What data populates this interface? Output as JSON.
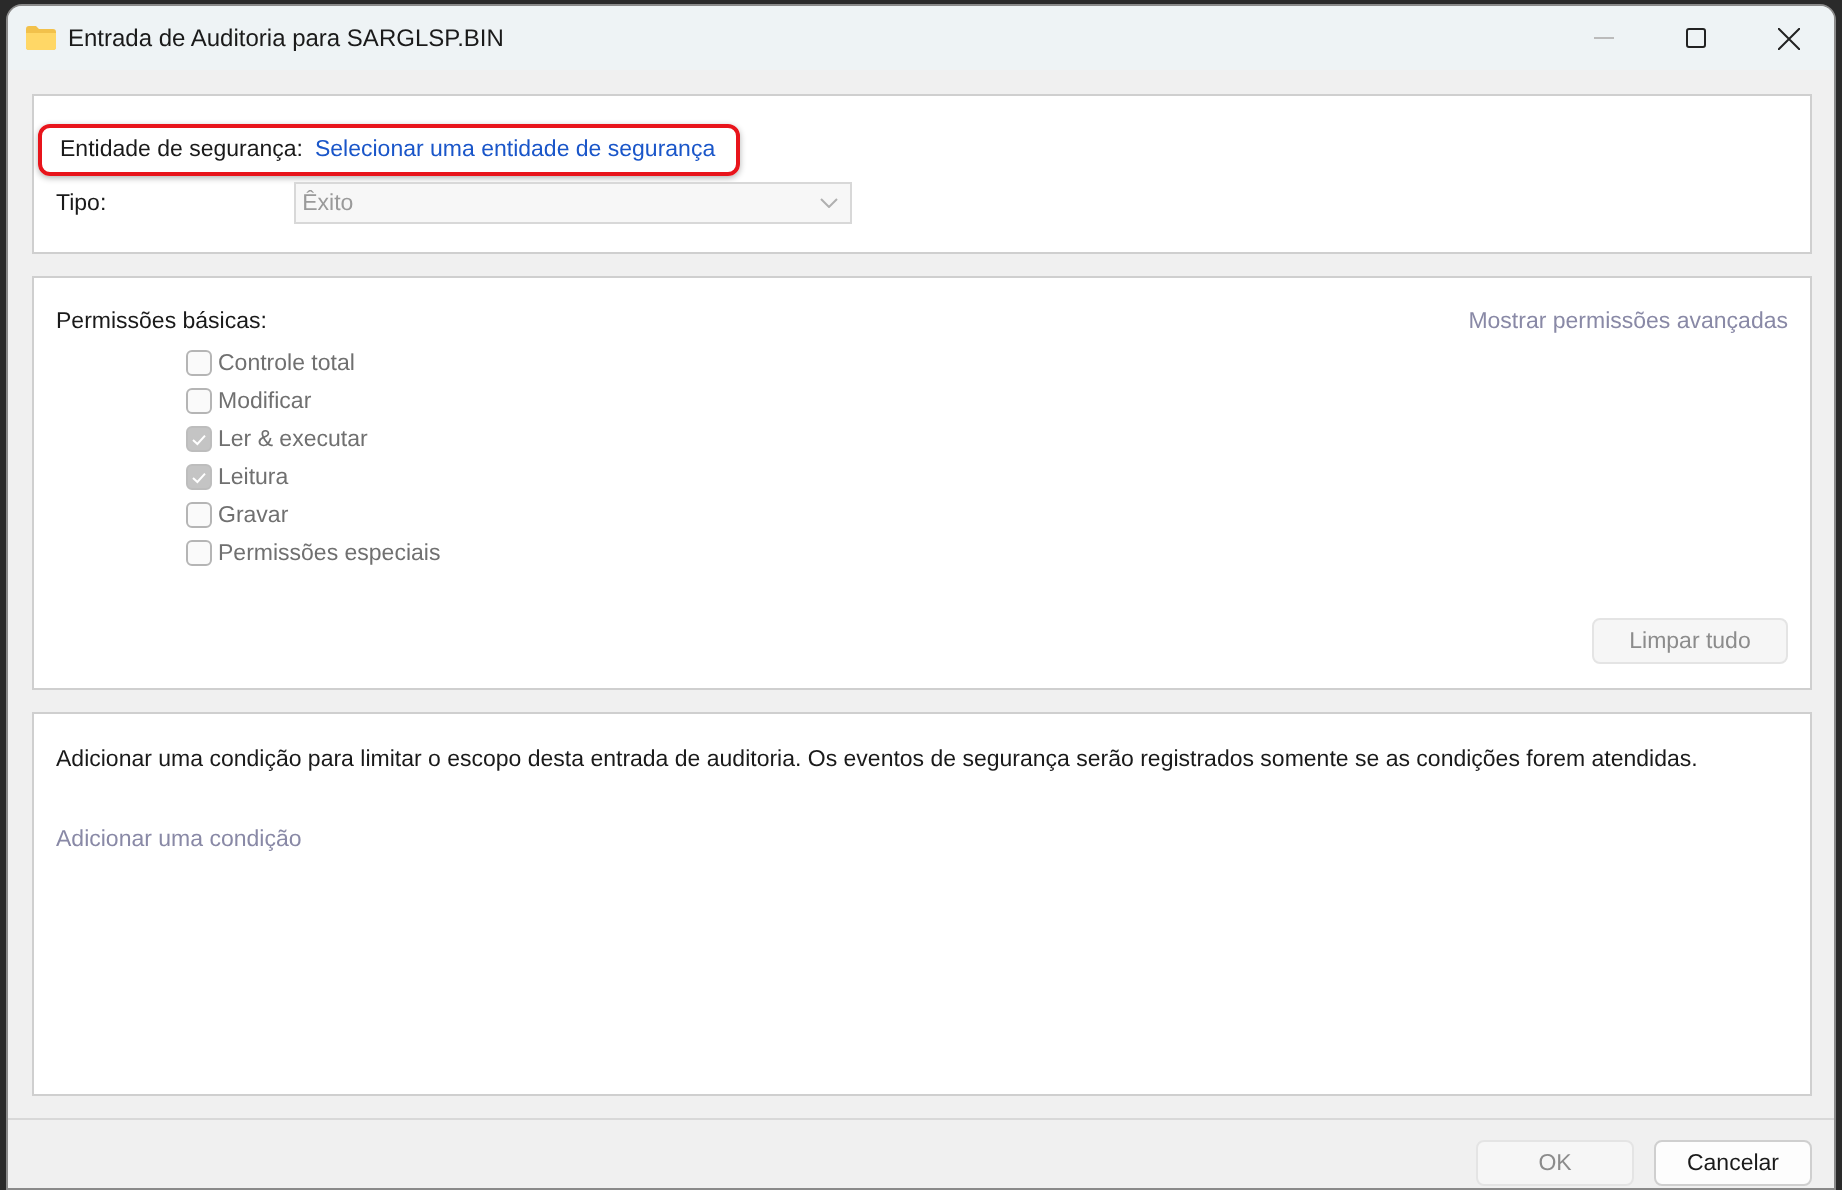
{
  "window": {
    "title": "Entrada de Auditoria para SARGLSP.BIN"
  },
  "principal": {
    "label": "Entidade de segurança:",
    "link": "Selecionar uma entidade de segurança",
    "highlighted": true
  },
  "type": {
    "label": "Tipo:",
    "value": "Êxito",
    "disabled": true
  },
  "permissions": {
    "label": "Permissões básicas:",
    "advanced_link": {
      "label": "Mostrar permissões avançadas",
      "disabled": true
    },
    "items": [
      {
        "label": "Controle total",
        "checked": false,
        "disabled": true
      },
      {
        "label": "Modificar",
        "checked": false,
        "disabled": true
      },
      {
        "label": "Ler & executar",
        "checked": true,
        "disabled": true
      },
      {
        "label": "Leitura",
        "checked": true,
        "disabled": true
      },
      {
        "label": "Gravar",
        "checked": false,
        "disabled": true
      },
      {
        "label": "Permissões especiais",
        "checked": false,
        "disabled": true
      }
    ],
    "clear_button": {
      "label": "Limpar tudo",
      "disabled": true
    }
  },
  "condition": {
    "description": "Adicionar uma condição para limitar o escopo desta entrada de auditoria. Os eventos de segurança serão registrados somente se as condições forem atendidas.",
    "add_link": {
      "label": "Adicionar uma condição",
      "disabled": true
    }
  },
  "buttons": [
    {
      "label": "OK",
      "disabled": true
    },
    {
      "label": "Cancelar",
      "disabled": false
    }
  ]
}
